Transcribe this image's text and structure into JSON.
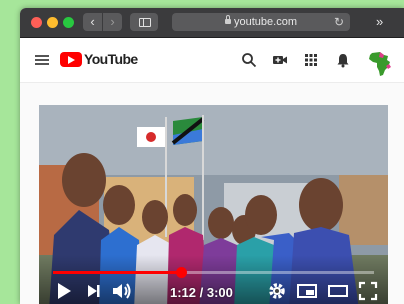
{
  "browser": {
    "url": "youtube.com",
    "back_glyph": "‹",
    "forward_glyph": "›",
    "reload_glyph": "↻",
    "overflow_glyph": "»"
  },
  "youtube": {
    "logo_text": "YouTube",
    "header_icons": [
      "menu-icon",
      "search-icon",
      "video-add-icon",
      "apps-icon",
      "bell-icon"
    ],
    "brand_color": "#ff0000"
  },
  "player": {
    "time_display": "1:12 / 3:00",
    "progress": 0.4,
    "controls": [
      "play-icon",
      "next-icon",
      "volume-icon",
      "settings-icon",
      "miniplayer-icon",
      "theater-icon",
      "fullscreen-icon"
    ]
  }
}
